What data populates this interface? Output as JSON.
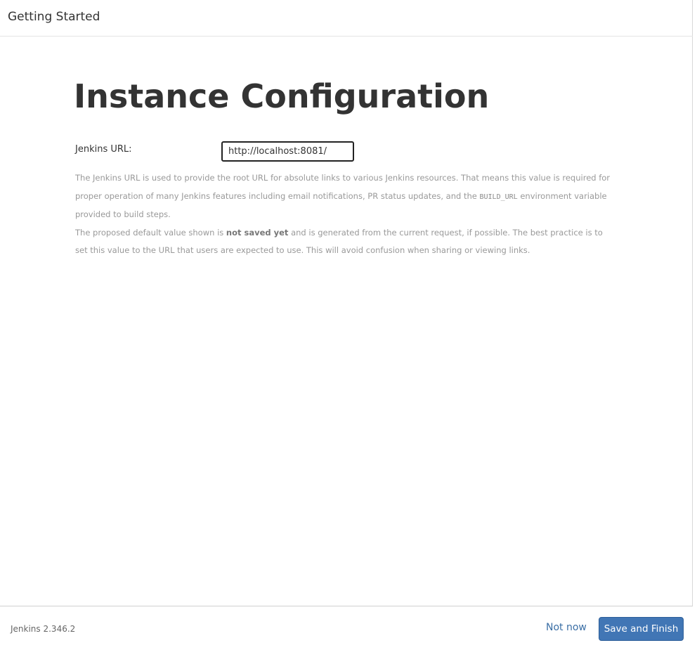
{
  "header": {
    "title": "Getting Started"
  },
  "main": {
    "title": "Instance Configuration",
    "url_field": {
      "label": "Jenkins URL:",
      "value": "http://localhost:8081/"
    },
    "help": {
      "p1_part1": "The Jenkins URL is used to provide the root URL for absolute links to various Jenkins resources. That means this value is required for proper operation of many Jenkins features including email notifications, PR status updates, and the ",
      "p1_code": "BUILD_URL",
      "p1_part2": " environment variable provided to build steps.",
      "p2_part1": "The proposed default value shown is ",
      "p2_bold": "not saved yet",
      "p2_part2": " and is generated from the current request, if possible. The best practice is to set this value to the URL that users are expected to use. This will avoid confusion when sharing or viewing links."
    }
  },
  "footer": {
    "version": "Jenkins 2.346.2",
    "not_now_label": "Not now",
    "save_label": "Save and Finish"
  },
  "colors": {
    "primary_button": "#4176b5",
    "link": "#3a6ea5",
    "help_text": "#999999"
  }
}
